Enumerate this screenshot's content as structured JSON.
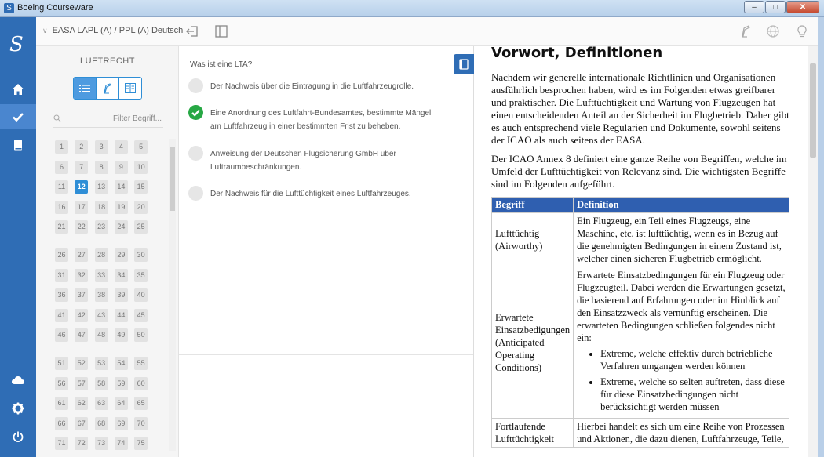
{
  "window": {
    "title": "Boeing Courseware",
    "buttons": [
      "–",
      "□",
      "✕"
    ]
  },
  "nav": {
    "items": [
      {
        "icon": "home-icon"
      },
      {
        "icon": "check-icon",
        "active": true
      },
      {
        "icon": "book-icon"
      }
    ],
    "bottom": [
      {
        "icon": "cloud-icon"
      },
      {
        "icon": "gear-icon"
      },
      {
        "icon": "power-icon"
      }
    ]
  },
  "topbar": {
    "course": "EASA LAPL (A) / PPL (A) Deutsch"
  },
  "sidebar": {
    "heading": "LUFTRECHT",
    "filter_placeholder": "Filter Begriff...",
    "groups": [
      [
        "1",
        "2",
        "3",
        "4",
        "5",
        "6",
        "7",
        "8",
        "9",
        "10",
        "11",
        "12",
        "13",
        "14",
        "15",
        "16",
        "17",
        "18",
        "19",
        "20",
        "21",
        "22",
        "23",
        "24",
        "25"
      ],
      [
        "26",
        "27",
        "28",
        "29",
        "30",
        "31",
        "32",
        "33",
        "34",
        "35",
        "36",
        "37",
        "38",
        "39",
        "40",
        "41",
        "42",
        "43",
        "44",
        "45",
        "46",
        "47",
        "48",
        "49",
        "50"
      ],
      [
        "51",
        "52",
        "53",
        "54",
        "55",
        "56",
        "57",
        "58",
        "59",
        "60",
        "61",
        "62",
        "63",
        "64",
        "65",
        "66",
        "67",
        "68",
        "69",
        "70",
        "71",
        "72",
        "73",
        "74",
        "75"
      ]
    ],
    "active": "12"
  },
  "question": {
    "prompt": "Was ist eine LTA?",
    "answers": [
      {
        "text": "Der Nachweis über die Eintragung in die Luftfahrzeugrolle.",
        "correct": false
      },
      {
        "text": "Eine Anordnung des Luftfahrt-Bundesamtes, bestimmte Mängel am Luftfahrzeug in einer bestimmten Frist zu beheben.",
        "correct": true
      },
      {
        "text": "Anweisung der Deutschen Flugsicherung GmbH über Luftraumbeschränkungen.",
        "correct": false
      },
      {
        "text": "Der Nachweis für die Lufttüchtigkeit eines Luftfahrzeuges.",
        "correct": false
      }
    ]
  },
  "reader": {
    "title": "Vorwort, Definitionen",
    "p1": "Nachdem wir generelle internationale Richtlinien und Organisationen ausführlich besprochen haben, wird es im Folgenden etwas greifbarer und praktischer. Die Lufttüchtigkeit und Wartung von Flugzeugen hat einen entscheidenden Anteil an der Sicherheit im Flugbetrieb. Daher gibt es auch entsprechend viele Regularien und Dokumente, sowohl seitens der ICAO als auch seitens der EASA.",
    "p2": "Der ICAO Annex 8 definiert eine ganze Reihe von Begriffen, welche im Umfeld der Lufttüchtigkeit von Relevanz sind. Die wichtigsten Begriffe sind im Folgenden aufgeführt.",
    "table": {
      "headers": [
        "Begriff",
        "Definition"
      ],
      "rows": [
        {
          "term": "Lufttüchtig (Airworthy)",
          "definition": "Ein Flugzeug, ein Teil eines Flugzeugs, eine Maschine, etc. ist lufttüchtig, wenn es in Bezug auf die genehmigten Bedingungen in einem Zustand ist, welcher einen sicheren Flugbetrieb ermöglicht."
        },
        {
          "term": "Erwartete Einsatzbedigungen (Anticipated Operating Conditions)",
          "definition": "Erwartete Einsatzbedingungen für ein Flugzeug oder Flugzeugteil. Dabei werden die Erwartungen gesetzt, die basierend auf Erfahrungen oder im Hinblick auf den Einsatzzweck als vernünftig erscheinen. Die erwarteten Bedingungen schließen folgendes nicht ein:",
          "bullets": [
            "Extreme, welche effektiv durch betriebliche Verfahren umgangen werden können",
            "Extreme, welche so selten auftreten, dass diese für diese Einsatzbedingungen nicht berücksichtigt werden müssen"
          ]
        },
        {
          "term": "Fortlaufende Lufttüchtigkeit",
          "definition": "Hierbei handelt es sich um eine Reihe von Prozessen und Aktionen, die dazu dienen, Luftfahrzeuge, Teile,"
        }
      ]
    }
  },
  "colors": {
    "nav": "#2f6db5",
    "accent": "#2f8ed6",
    "correct": "#27a844",
    "table_header": "#2f5fb0"
  }
}
